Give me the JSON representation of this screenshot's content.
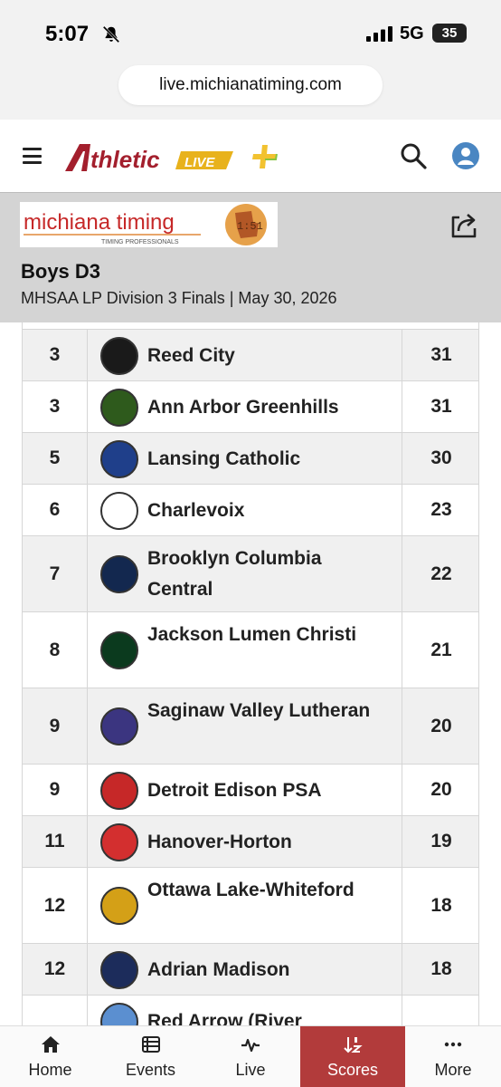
{
  "status_bar": {
    "time": "5:07",
    "network": "5G",
    "battery": "35"
  },
  "browser": {
    "url": "live.michianatiming.com"
  },
  "header": {
    "logo_text": "thletic",
    "logo_live": "LIVE"
  },
  "event": {
    "title": "Boys D3",
    "subtitle": "MHSAA LP Division 3 Finals | May 30, 2026",
    "timer_logo_text": "michiana timing",
    "timer_logo_tagline": "TIMING PROFESSIONALS"
  },
  "results": [
    {
      "place": "3",
      "team": "Reed City",
      "score": "31",
      "logo_color": "#1a1a1a"
    },
    {
      "place": "3",
      "team": "Ann Arbor Greenhills",
      "score": "31",
      "logo_color": "#2e5a1c"
    },
    {
      "place": "5",
      "team": "Lansing Catholic",
      "score": "30",
      "logo_color": "#1f3f8a"
    },
    {
      "place": "6",
      "team": "Charlevoix",
      "score": "23",
      "logo_color": "#ffffff"
    },
    {
      "place": "7",
      "team": "Brooklyn Columbia Central",
      "score": "22",
      "logo_color": "#13284f"
    },
    {
      "place": "8",
      "team": "Jackson Lumen Christi",
      "score": "21",
      "logo_color": "#0b3a1e"
    },
    {
      "place": "9",
      "team": "Saginaw Valley Lutheran",
      "score": "20",
      "logo_color": "#3b3580"
    },
    {
      "place": "9",
      "team": "Detroit Edison PSA",
      "score": "20",
      "logo_color": "#c62828"
    },
    {
      "place": "11",
      "team": "Hanover-Horton",
      "score": "19",
      "logo_color": "#d32f2f"
    },
    {
      "place": "12",
      "team": "Ottawa Lake-Whiteford",
      "score": "18",
      "logo_color": "#d4a017"
    },
    {
      "place": "12",
      "team": "Adrian Madison",
      "score": "18",
      "logo_color": "#1c2c5b"
    },
    {
      "place": "",
      "team": "Red Arrow (River",
      "score": "",
      "logo_color": "#5b8fd0"
    }
  ],
  "bottom_nav": [
    {
      "label": "Home",
      "icon": "home-icon"
    },
    {
      "label": "Events",
      "icon": "list-icon"
    },
    {
      "label": "Live",
      "icon": "pulse-icon"
    },
    {
      "label": "Scores",
      "icon": "sort-icon",
      "active": true
    },
    {
      "label": "More",
      "icon": "more-icon"
    }
  ],
  "colors": {
    "accent": "#b23b3b",
    "banner": "#d4d4d4",
    "logo_red": "#a31f2d"
  }
}
